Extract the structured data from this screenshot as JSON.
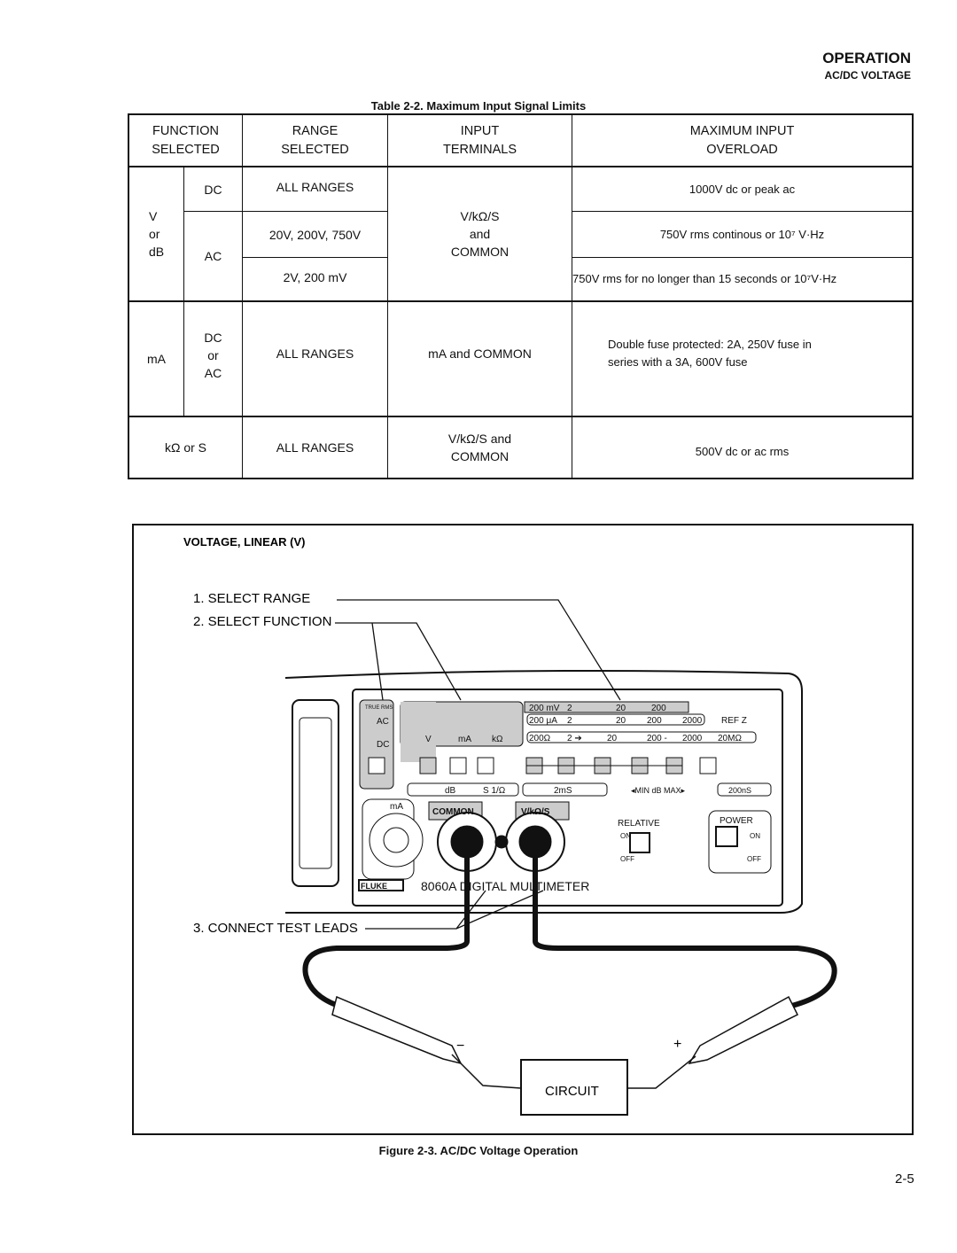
{
  "header": {
    "section": "OPERATION",
    "subsection": "AC/DC VOLTAGE"
  },
  "table": {
    "caption": "Table 2-2. Maximum Input Signal Limits",
    "columns": [
      [
        "FUNCTION",
        "SELECTED"
      ],
      [
        "RANGE",
        "SELECTED"
      ],
      [
        "INPUT",
        "TERMINALS"
      ],
      [
        "MAXIMUM INPUT",
        "OVERLOAD"
      ]
    ],
    "v_group": {
      "function": [
        "V",
        "or",
        "dB"
      ],
      "dc": "DC",
      "ac": "AC",
      "ranges": [
        "ALL RANGES",
        "20V, 200V, 750V",
        "2V, 200 mV"
      ],
      "terminals": [
        "V/kΩ/S",
        "and",
        "COMMON"
      ],
      "overloads": [
        "1000V dc or peak ac",
        "750V rms continous or 10⁷ V·Hz",
        "750V rms for no longer than 15 seconds or 10⁷V·Hz"
      ]
    },
    "ma_group": {
      "function": "mA",
      "mode": [
        "DC",
        "or",
        "AC"
      ],
      "range": "ALL RANGES",
      "terminals": "mA and COMMON",
      "overload": [
        "Double fuse protected:  2A, 250V fuse in",
        "series with a 3A, 600V fuse"
      ]
    },
    "k_group": {
      "function": "kΩ or S",
      "range": "ALL RANGES",
      "terminals": [
        "V/kΩ/S and",
        "COMMON"
      ],
      "overload": "500V dc or ac rms"
    }
  },
  "figure": {
    "heading": "VOLTAGE, LINEAR (V)",
    "steps": [
      "1. SELECT RANGE",
      "2. SELECT FUNCTION",
      "3. CONNECT TEST LEADS"
    ],
    "circuit_label": "CIRCUIT",
    "probe_minus": "−",
    "probe_plus": "+",
    "meter": {
      "model": "8060A DIGITAL MULTIMETER",
      "brand": "FLUKE",
      "ac": "AC",
      "dc": "DC",
      "true_rms": "TRUE RMS",
      "func_v": "V",
      "func_ma": "mA",
      "func_k": "kΩ",
      "range_row1": [
        "200 mV",
        "2",
        "20",
        "200"
      ],
      "range_row2": [
        "200 μA",
        "2",
        "20",
        "200",
        "2000",
        "REF Z"
      ],
      "range_row3": [
        "200Ω",
        "2 ➔",
        "20",
        "200 -",
        "2000",
        "20MΩ"
      ],
      "sub_labels": [
        "dB",
        "S 1/Ω",
        "2mS",
        "◂MIN dB MAX▸",
        "200nS"
      ],
      "terminals": [
        "mA",
        "COMMON",
        "V/kΩ/S"
      ],
      "relative": "RELATIVE",
      "power": "POWER",
      "on": "ON",
      "off": "OFF"
    },
    "caption": "Figure 2-3. AC/DC Voltage Operation"
  },
  "page_number": "2-5"
}
